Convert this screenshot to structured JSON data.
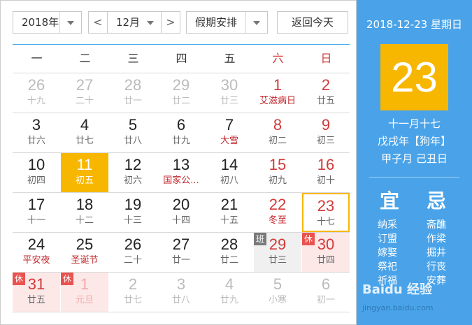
{
  "toolbar": {
    "year_value": "2018年",
    "month_value": "12月",
    "holiday_value": "假期安排",
    "prev_label": "<",
    "next_label": ">",
    "today_label": "返回今天"
  },
  "weekdays": [
    "一",
    "二",
    "三",
    "四",
    "五",
    "六",
    "日"
  ],
  "weeks": [
    [
      {
        "day": "26",
        "lunar": "十九",
        "dim": true
      },
      {
        "day": "27",
        "lunar": "二十",
        "dim": true
      },
      {
        "day": "28",
        "lunar": "廿一",
        "dim": true
      },
      {
        "day": "29",
        "lunar": "廿二",
        "dim": true
      },
      {
        "day": "30",
        "lunar": "廿三",
        "dim": true
      },
      {
        "day": "1",
        "lunar": "艾滋病日",
        "festival": true,
        "weekend": true
      },
      {
        "day": "2",
        "lunar": "廿五",
        "weekend": true
      }
    ],
    [
      {
        "day": "3",
        "lunar": "廿六"
      },
      {
        "day": "4",
        "lunar": "廿七"
      },
      {
        "day": "5",
        "lunar": "廿八"
      },
      {
        "day": "6",
        "lunar": "廿九"
      },
      {
        "day": "7",
        "lunar": "大雪",
        "festival": true
      },
      {
        "day": "8",
        "lunar": "初二",
        "weekend": true
      },
      {
        "day": "9",
        "lunar": "初三",
        "weekend": true
      }
    ],
    [
      {
        "day": "10",
        "lunar": "初四"
      },
      {
        "day": "11",
        "lunar": "初五",
        "selected": true
      },
      {
        "day": "12",
        "lunar": "初六"
      },
      {
        "day": "13",
        "lunar": "国家公...",
        "festival": true
      },
      {
        "day": "14",
        "lunar": "初八"
      },
      {
        "day": "15",
        "lunar": "初九",
        "weekend": true
      },
      {
        "day": "16",
        "lunar": "初十",
        "weekend": true
      }
    ],
    [
      {
        "day": "17",
        "lunar": "十一"
      },
      {
        "day": "18",
        "lunar": "十二"
      },
      {
        "day": "19",
        "lunar": "十三"
      },
      {
        "day": "20",
        "lunar": "十四"
      },
      {
        "day": "21",
        "lunar": "十五"
      },
      {
        "day": "22",
        "lunar": "冬至",
        "festival": true,
        "weekend": true
      },
      {
        "day": "23",
        "lunar": "十七",
        "weekend": true,
        "today": true
      }
    ],
    [
      {
        "day": "24",
        "lunar": "平安夜",
        "festival": true
      },
      {
        "day": "25",
        "lunar": "圣诞节",
        "festival": true
      },
      {
        "day": "26",
        "lunar": "二十"
      },
      {
        "day": "27",
        "lunar": "廿一"
      },
      {
        "day": "28",
        "lunar": "廿二"
      },
      {
        "day": "29",
        "lunar": "廿三",
        "workday": true,
        "badge": "班",
        "weekend": true
      },
      {
        "day": "30",
        "lunar": "廿四",
        "holiday": true,
        "badge": "休",
        "weekend": true
      }
    ],
    [
      {
        "day": "31",
        "lunar": "廿五",
        "holiday": true,
        "badge": "休"
      },
      {
        "day": "1",
        "lunar": "元旦",
        "holiday": true,
        "badge": "休",
        "dim": true
      },
      {
        "day": "2",
        "lunar": "廿七",
        "dim": true
      },
      {
        "day": "3",
        "lunar": "廿八",
        "dim": true
      },
      {
        "day": "4",
        "lunar": "廿九",
        "dim": true
      },
      {
        "day": "5",
        "lunar": "小寒",
        "dim": true
      },
      {
        "day": "6",
        "lunar": "初一",
        "dim": true
      }
    ]
  ],
  "panel": {
    "date_line": "2018-12-23 星期日",
    "big_day": "23",
    "lunar_date": "十一月十七",
    "year_ganzhi": "戊戌年【狗年】",
    "month_day_ganzhi": "甲子月 己丑日",
    "yi_title": "宜",
    "ji_title": "忌",
    "yi_items": [
      "纳采",
      "订盟",
      "嫁娶",
      "祭祀",
      "祈福"
    ],
    "ji_items": [
      "斋醮",
      "作梁",
      "掘井",
      "行丧",
      "安葬"
    ]
  },
  "watermark": {
    "text": "Baidu 经验",
    "url": "jingyan.baidu.com"
  }
}
